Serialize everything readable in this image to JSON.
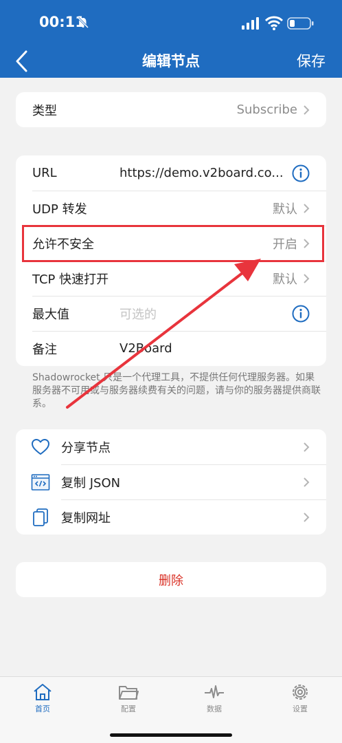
{
  "status_bar": {
    "time": "00:11"
  },
  "nav": {
    "title": "编辑节点",
    "save_label": "保存"
  },
  "type_row": {
    "label": "类型",
    "value": "Subscribe"
  },
  "settings": {
    "url_label": "URL",
    "url_value": "https://demo.v2board.co...",
    "udp_label": "UDP 转发",
    "udp_value": "默认",
    "insecure_label": "允许不安全",
    "insecure_value": "开启",
    "tcp_fast_label": "TCP 快速打开",
    "tcp_fast_value": "默认",
    "max_label": "最大值",
    "max_placeholder": "可选的",
    "remark_label": "备注",
    "remark_value": "V2Board"
  },
  "note": "Shadowrocket 只是一个代理工具，不提供任何代理服务器。如果服务器不可用或与服务器续费有关的问题，请与你的服务器提供商联系。",
  "actions": [
    {
      "label": "分享节点",
      "icon": "heart-icon"
    },
    {
      "label": "复制 JSON",
      "icon": "code-window-icon"
    },
    {
      "label": "复制网址",
      "icon": "copy-icon"
    }
  ],
  "delete_label": "删除",
  "tabs": [
    {
      "label": "首页",
      "icon": "home-icon"
    },
    {
      "label": "配置",
      "icon": "folder-icon"
    },
    {
      "label": "数据",
      "icon": "pulse-icon"
    },
    {
      "label": "设置",
      "icon": "gear-icon"
    }
  ],
  "colors": {
    "brand": "#1f6cc0",
    "delete": "#d93025",
    "annotation": "#e8343c",
    "background": "#f2f2f2"
  }
}
